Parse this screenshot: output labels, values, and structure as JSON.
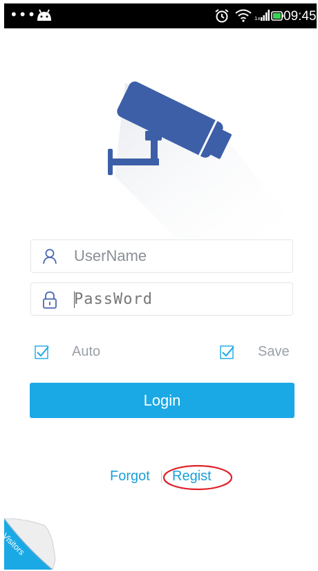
{
  "status_bar": {
    "dots": "•••",
    "time": "09:45AM"
  },
  "form": {
    "username_placeholder": "UserName",
    "password_placeholder": "PassWord"
  },
  "options": {
    "auto_label": "Auto",
    "save_label": "Save",
    "auto_checked": true,
    "save_checked": true
  },
  "login_button": "Login",
  "links": {
    "forgot": "Forgot",
    "regist": "Regist"
  },
  "visitors": "Visitors",
  "colors": {
    "accent": "#1aa9e4",
    "logo": "#3d5fa8",
    "highlight_ring": "#e0202a"
  }
}
